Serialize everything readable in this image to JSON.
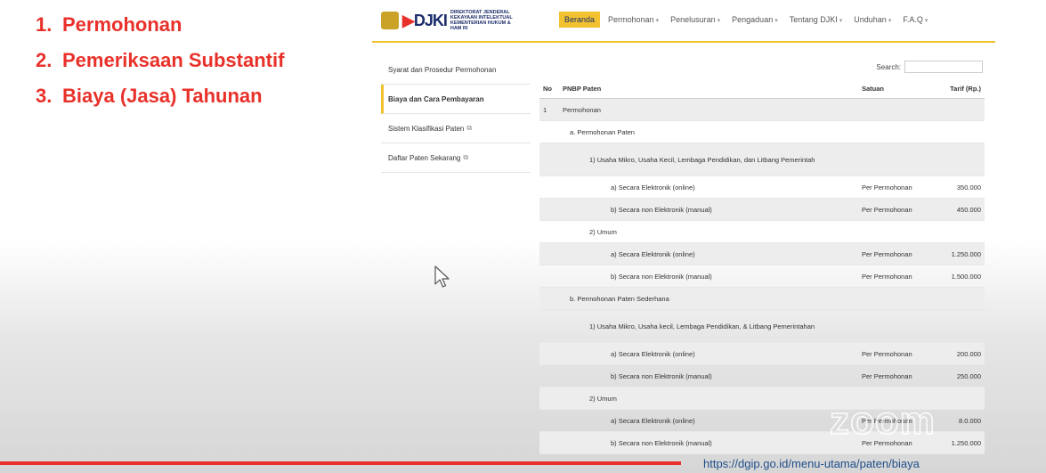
{
  "slide": {
    "items": [
      {
        "num": "1.",
        "label": "Permohonan"
      },
      {
        "num": "2.",
        "label": "Pemeriksaan Substantif"
      },
      {
        "num": "3.",
        "label": "Biaya (Jasa) Tahunan"
      }
    ]
  },
  "header": {
    "logo_text": "DJKI",
    "org_line1": "DIREKTORAT JENDERAL",
    "org_line2": "KEKAYAAN INTELEKTUAL",
    "org_line3": "KEMENTERIAN HUKUM & HAM RI",
    "nav": [
      {
        "label": "Beranda",
        "active": true,
        "dropdown": false
      },
      {
        "label": "Permohonan",
        "active": false,
        "dropdown": true
      },
      {
        "label": "Penelusuran",
        "active": false,
        "dropdown": true
      },
      {
        "label": "Pengaduan",
        "active": false,
        "dropdown": true
      },
      {
        "label": "Tentang DJKI",
        "active": false,
        "dropdown": true
      },
      {
        "label": "Unduhan",
        "active": false,
        "dropdown": true
      },
      {
        "label": "F.A.Q",
        "active": false,
        "dropdown": true
      }
    ]
  },
  "sidebar": {
    "items": [
      {
        "label": "Syarat dan Prosedur Permohonan"
      },
      {
        "label": "Biaya dan Cara Pembayaran"
      },
      {
        "label": "Sistem Klasifikasi Paten"
      },
      {
        "label": "Daftar Paten Sekarang"
      }
    ]
  },
  "search": {
    "label": "Search:",
    "value": ""
  },
  "table": {
    "headers": {
      "no": "No",
      "name": "PNBP Paten",
      "unit": "Satuan",
      "fee": "Tarif (Rp.)"
    },
    "rows": [
      {
        "no": "1",
        "name": "Permohonan",
        "unit": "",
        "fee": ""
      },
      {
        "no": "",
        "name": "a. Permohonan Paten",
        "unit": "",
        "fee": ""
      },
      {
        "no": "",
        "name": "1) Usaha Mikro, Usaha Kecil, Lembaga Pendidikan, dan Litbang Pemerintah",
        "unit": "",
        "fee": ""
      },
      {
        "no": "",
        "name": "a) Secara Elektronik (online)",
        "unit": "Per Permohonan",
        "fee": "350.000"
      },
      {
        "no": "",
        "name": "b) Secara non Elektronik (manual)",
        "unit": "Per Permohonan",
        "fee": "450.000"
      },
      {
        "no": "",
        "name": "2) Umum",
        "unit": "",
        "fee": ""
      },
      {
        "no": "",
        "name": "a) Secara Elektronik (online)",
        "unit": "Per Permohonan",
        "fee": "1.250.000"
      },
      {
        "no": "",
        "name": "b) Secara non Elektronik (manual)",
        "unit": "Per Permohonan",
        "fee": "1.500.000"
      },
      {
        "no": "",
        "name": "b. Permohonan Paten Sederhana",
        "unit": "",
        "fee": ""
      },
      {
        "no": "",
        "name": "1) Usaha Mikro, Usaha kecil, Lembaga Pendidikan, & Litbang Pemerintahan",
        "unit": "",
        "fee": ""
      },
      {
        "no": "",
        "name": "a) Secara Elektronik (online)",
        "unit": "Per Permohonan",
        "fee": "200.000"
      },
      {
        "no": "",
        "name": "b) Secara non Elektronik (manual)",
        "unit": "Per Permohonan",
        "fee": "250.000"
      },
      {
        "no": "",
        "name": "2) Umum",
        "unit": "",
        "fee": ""
      },
      {
        "no": "",
        "name": "a) Secara Elektronik (online)",
        "unit": "Per Permohonan",
        "fee": "8.0.000"
      },
      {
        "no": "",
        "name": "b) Secara non Elektronik (manual)",
        "unit": "Per Permohonan",
        "fee": "1.250.000"
      }
    ]
  },
  "watermark": "zoom",
  "url": "https://dgip.go.id/menu-utama/paten/biaya",
  "colors": {
    "accent": "#f2c230",
    "slide_text": "#e8312a",
    "bar": "#e8312a",
    "url": "#1f4e8a"
  }
}
